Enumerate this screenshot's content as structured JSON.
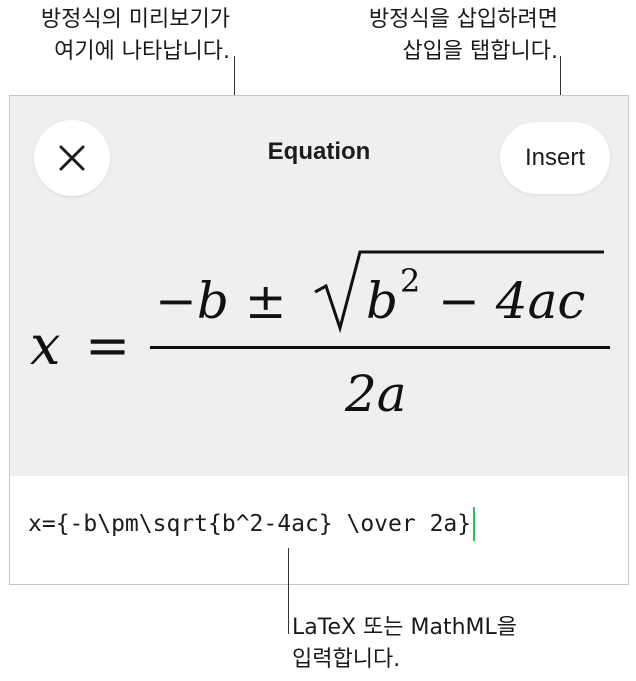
{
  "callouts": {
    "preview_line1": "방정식의 미리보기가",
    "preview_line2": "여기에 나타납니다.",
    "insert_line1": "방정식을 삽입하려면",
    "insert_line2": "삽입을 탭합니다.",
    "input_line1": "LaTeX 또는 MathML을",
    "input_line2": "입력합니다."
  },
  "dialog": {
    "title": "Equation",
    "insert_label": "Insert",
    "close_icon": "xmark-icon"
  },
  "equation": {
    "lhs": "x",
    "equals": "=",
    "numerator_minus_b": "−b ±",
    "radicand_base": "b",
    "radicand_exponent": "2",
    "radicand_rest": "− 4ac",
    "denominator": "2a"
  },
  "input": {
    "latex": "x={-b\\pm\\sqrt{b^2-4ac} \\over 2a}"
  },
  "colors": {
    "preview_background": "#efeff0",
    "caret": "#30c05a",
    "border": "#c6c6c8"
  }
}
